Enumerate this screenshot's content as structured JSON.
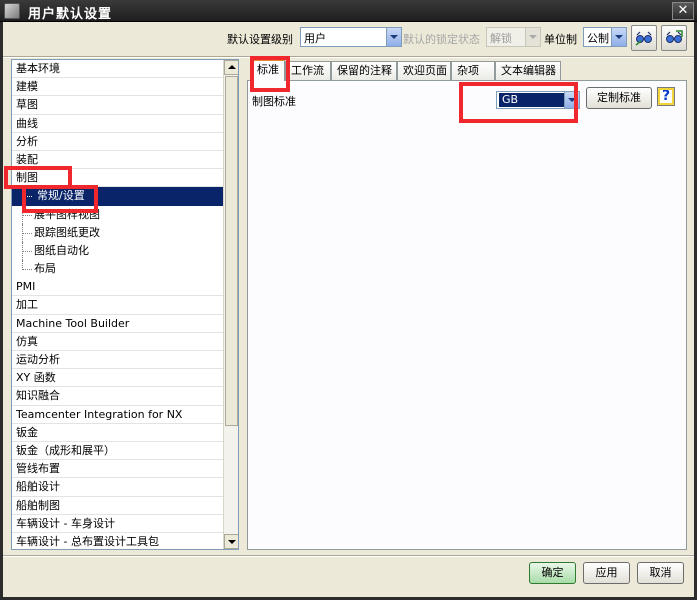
{
  "window": {
    "title": "用户默认设置",
    "close_glyph": "✕"
  },
  "toolbar": {
    "level_label": "默认设置级别",
    "level_value": "用户",
    "lock_label": "默认的锁定状态",
    "lock_value": "解锁",
    "unit_label": "单位制",
    "unit_value": "公制",
    "import_icon": "glasses-import-icon",
    "export_icon": "glasses-export-icon"
  },
  "tree": {
    "items": [
      {
        "label": "基本环境",
        "level": 0
      },
      {
        "label": "建模",
        "level": 0
      },
      {
        "label": "草图",
        "level": 0
      },
      {
        "label": "曲线",
        "level": 0
      },
      {
        "label": "分析",
        "level": 0
      },
      {
        "label": "装配",
        "level": 0
      },
      {
        "label": "制图",
        "level": 0
      },
      {
        "label": "常规/设置",
        "level": 1,
        "selected": true
      },
      {
        "label": "展平图样视图",
        "level": 1
      },
      {
        "label": "跟踪图纸更改",
        "level": 1
      },
      {
        "label": "图纸自动化",
        "level": 1
      },
      {
        "label": "布局",
        "level": 1
      },
      {
        "label": "PMI",
        "level": 0
      },
      {
        "label": "加工",
        "level": 0
      },
      {
        "label": "Machine Tool Builder",
        "level": 0
      },
      {
        "label": "仿真",
        "level": 0
      },
      {
        "label": "运动分析",
        "level": 0
      },
      {
        "label": "XY 函数",
        "level": 0
      },
      {
        "label": "知识融合",
        "level": 0
      },
      {
        "label": "Teamcenter Integration for NX",
        "level": 0
      },
      {
        "label": "钣金",
        "level": 0
      },
      {
        "label": "钣金（成形和展平）",
        "level": 0
      },
      {
        "label": "管线布置",
        "level": 0
      },
      {
        "label": "船舶设计",
        "level": 0
      },
      {
        "label": "船舶制图",
        "level": 0
      },
      {
        "label": "车辆设计 - 车身设计",
        "level": 0
      },
      {
        "label": "车辆设计 - 总布置设计工具包",
        "level": 0
      }
    ]
  },
  "tabs": [
    "标准",
    "工作流",
    "保留的注释",
    "欢迎页面",
    "杂项",
    "文本编辑器"
  ],
  "panel": {
    "field_label": "制图标准",
    "standard_value": "GB",
    "customize_label": "定制标准",
    "help_glyph": "?"
  },
  "footer": {
    "ok_label": "确定",
    "apply_label": "应用",
    "cancel_label": "取消"
  },
  "colors": {
    "highlight": "#f0282d",
    "selection": "#0a246a",
    "active_tab_accent": "#e68b2c"
  }
}
